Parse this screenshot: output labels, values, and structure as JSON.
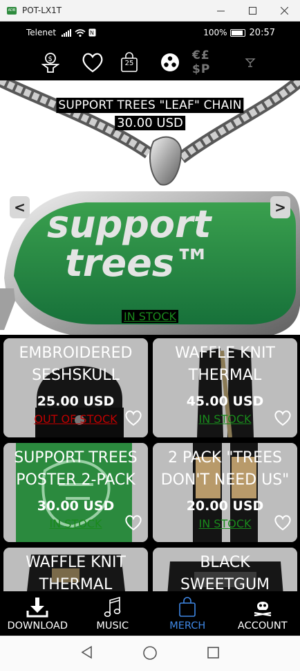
{
  "window": {
    "title": "POT-LX1T",
    "app_icon_text": "ADB"
  },
  "statusbar": {
    "carrier": "Telenet",
    "battery_percent": "100%",
    "time": "20:57"
  },
  "topnav": {
    "bag_count": "25",
    "currency_label": "€£$P"
  },
  "hero": {
    "title": "SUPPORT TREES \"LEAF\"  CHAIN",
    "price": "30.00 USD",
    "stock": "IN STOCK",
    "prev_label": "<",
    "next_label": ">",
    "pendant_text_1": "support",
    "pendant_text_2": "trees™"
  },
  "products": [
    {
      "title": "EMBROIDERED\nSESHSKULL",
      "price": "25.00 USD",
      "stock": "OUT OF STOCK",
      "stock_color": "#c00000"
    },
    {
      "title": "WAFFLE KNIT\nTHERMAL",
      "price": "45.00 USD",
      "stock": "IN STOCK",
      "stock_color": "#198a1c"
    },
    {
      "title": "SUPPORT TREES\nPOSTER 2-PACK",
      "price": "30.00 USD",
      "stock": "IN STOCK",
      "stock_color": "#198a1c"
    },
    {
      "title": "2 PACK  \"TREES\nDON'T NEED US\"",
      "price": "20.00 USD",
      "stock": "IN STOCK",
      "stock_color": "#198a1c"
    },
    {
      "title": "WAFFLE KNIT\nTHERMAL",
      "price": "",
      "stock": "",
      "stock_color": "#198a1c"
    },
    {
      "title": "BLACK\nSWEETGUM",
      "price": "",
      "stock": "",
      "stock_color": "#198a1c"
    }
  ],
  "bottomnav": {
    "items": [
      {
        "label": "DOWNLOAD"
      },
      {
        "label": "MUSIC"
      },
      {
        "label": "MERCH"
      },
      {
        "label": "ACCOUNT"
      }
    ],
    "active_color": "#3f88e6"
  }
}
